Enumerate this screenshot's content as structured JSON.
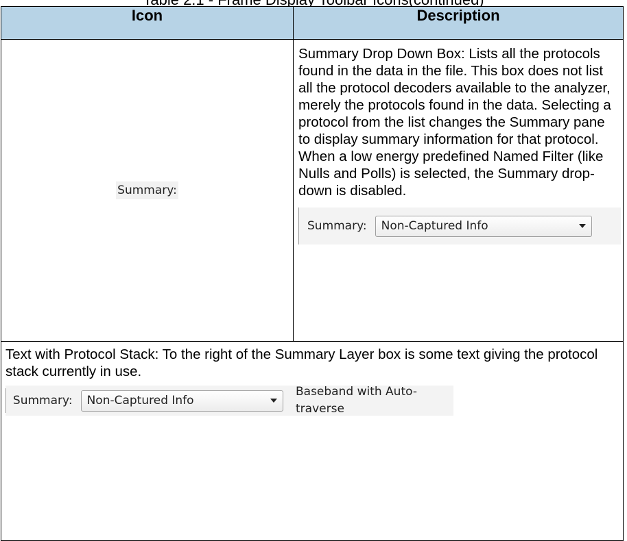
{
  "caption": "Table 2.1 - Frame Display Toolbar Icons(continued)",
  "table": {
    "header_icon": "Icon",
    "header_description": "Description"
  },
  "row1": {
    "icon_label": "Summary:",
    "description": "Summary Drop Down Box: Lists all the protocols found in the data in the file. This box does not list all the protocol decoders available to the analyzer, merely the protocols found in the data. Selecting a protocol from the list changes the Summary pane to display summary information for that protocol.  When a low energy predefined Named Filter (like Nulls and Polls) is selected, the Summary drop-down is disabled.",
    "toolbar_label": "Summary:",
    "combo_value": "Non-Captured Info"
  },
  "row2": {
    "description": "Text with Protocol Stack: To the right of the Summary Layer box is some text giving the protocol stack currently in use.",
    "toolbar_label": "Summary:",
    "combo_value": "Non-Captured Info",
    "stack_text": "Baseband with Auto-traverse"
  }
}
